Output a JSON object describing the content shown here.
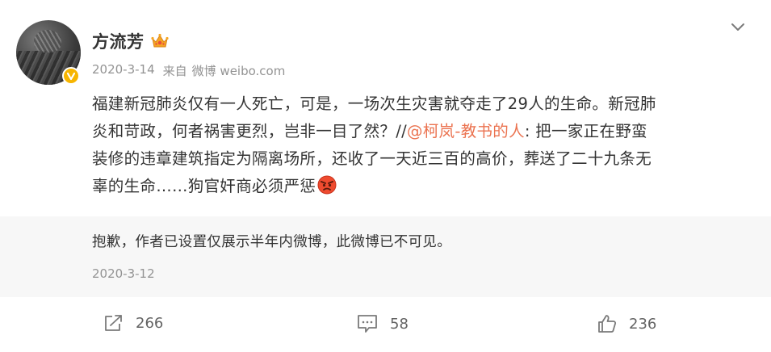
{
  "post": {
    "author": {
      "name": "方流芳",
      "avatar_icon": "avatar-image",
      "verified_icon": "verified-v-badge-icon",
      "vip_icon": "crown-vip-icon"
    },
    "meta": {
      "date": "2020-3-14",
      "source_prefix": "来自",
      "source": "微博 weibo.com"
    },
    "content": {
      "line1": "福建新冠肺炎仅有一人死亡，可是，一场次生灾害就夺走了29人的生命。新冠肺",
      "line2_before": "炎和苛政，何者祸害更烈，岂非一目了然？//",
      "mention": "@柯岚-教书的人",
      "line2_after": ": 把一家正在野蛮",
      "line3": "装修的违章建筑指定为隔离场所，还收了一天近三百的高价，葬送了二十九条无",
      "line4": "辜的生命……狗官奸商必须严惩",
      "emoji_icon": "angry-face-emoji"
    },
    "retweet": {
      "text": "抱歉，作者已设置仅展示半年内微博，此微博已不可见。",
      "date": "2020-3-12"
    },
    "actions": {
      "share_count": "266",
      "comment_count": "58",
      "like_count": "236"
    }
  },
  "colors": {
    "mention": "#eb7350",
    "meta_gray": "#939393",
    "retweet_bg": "#f7f7f7",
    "verified_badge": "#f7b500"
  }
}
